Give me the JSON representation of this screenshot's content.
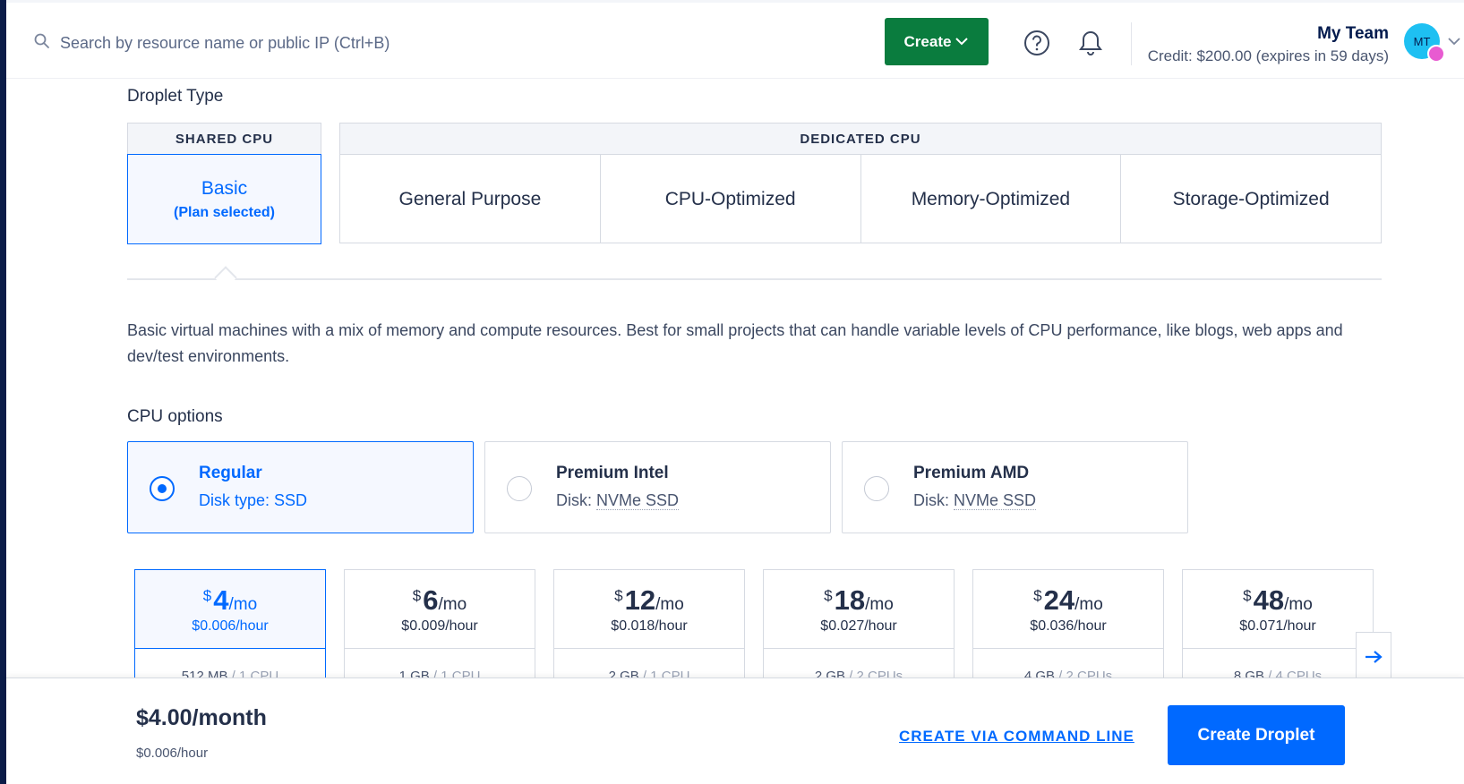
{
  "header": {
    "search_placeholder": "Search by resource name or public IP (Ctrl+B)",
    "create_label": "Create",
    "team_name": "My Team",
    "credit": "Credit: $200.00 (expires in 59 days)",
    "avatar_initials": "MT"
  },
  "droplet_type": {
    "title": "Droplet Type",
    "shared_header": "SHARED CPU",
    "shared_plan": "Basic",
    "shared_plan_status": "(Plan selected)",
    "dedicated_header": "DEDICATED CPU",
    "dedicated_plans": [
      "General Purpose",
      "CPU-Optimized",
      "Memory-Optimized",
      "Storage-Optimized"
    ]
  },
  "description": "Basic virtual machines with a mix of memory and compute resources. Best for small projects that can handle variable levels of CPU performance, like blogs, web apps and dev/test environments.",
  "cpu_options": {
    "title": "CPU options",
    "options": [
      {
        "name": "Regular",
        "sub_label": "Disk type: SSD",
        "selected": true
      },
      {
        "name": "Premium Intel",
        "sub_prefix": "Disk: ",
        "sub_value": "NVMe SSD",
        "selected": false
      },
      {
        "name": "Premium AMD",
        "sub_prefix": "Disk: ",
        "sub_value": "NVMe SSD",
        "selected": false
      }
    ]
  },
  "plans": [
    {
      "currency": "$",
      "price": "4",
      "unit": "/mo",
      "hourly": "$0.006",
      "hour_unit": "/hour",
      "memory": "512 MB",
      "cpu": " / 1 CPU",
      "selected": true
    },
    {
      "currency": "$",
      "price": "6",
      "unit": "/mo",
      "hourly": "$0.009",
      "hour_unit": "/hour",
      "memory": "1 GB",
      "cpu": " / 1 CPU",
      "selected": false
    },
    {
      "currency": "$",
      "price": "12",
      "unit": "/mo",
      "hourly": "$0.018",
      "hour_unit": "/hour",
      "memory": "2 GB",
      "cpu": " / 1 CPU",
      "selected": false
    },
    {
      "currency": "$",
      "price": "18",
      "unit": "/mo",
      "hourly": "$0.027",
      "hour_unit": "/hour",
      "memory": "2 GB",
      "cpu": " / 2 CPUs",
      "selected": false
    },
    {
      "currency": "$",
      "price": "24",
      "unit": "/mo",
      "hourly": "$0.036",
      "hour_unit": "/hour",
      "memory": "4 GB",
      "cpu": " / 2 CPUs",
      "selected": false
    },
    {
      "currency": "$",
      "price": "48",
      "unit": "/mo",
      "hourly": "$0.071",
      "hour_unit": "/hour",
      "memory": "8 GB",
      "cpu": " / 4 CPUs",
      "selected": false
    }
  ],
  "footer": {
    "monthly_total": "$4.00/month",
    "hourly_total": "$0.006/hour",
    "cli_link": "CREATE VIA COMMAND LINE",
    "create_button": "Create Droplet"
  },
  "colors": {
    "accent": "#0069ff",
    "create_green": "#0a7c3e",
    "nav_dark": "#0b1c48",
    "avatar": "#1ec0f2"
  },
  "icons": [
    "search-icon",
    "chevron-down-icon",
    "help-icon",
    "bell-icon",
    "arrow-right-icon"
  ]
}
